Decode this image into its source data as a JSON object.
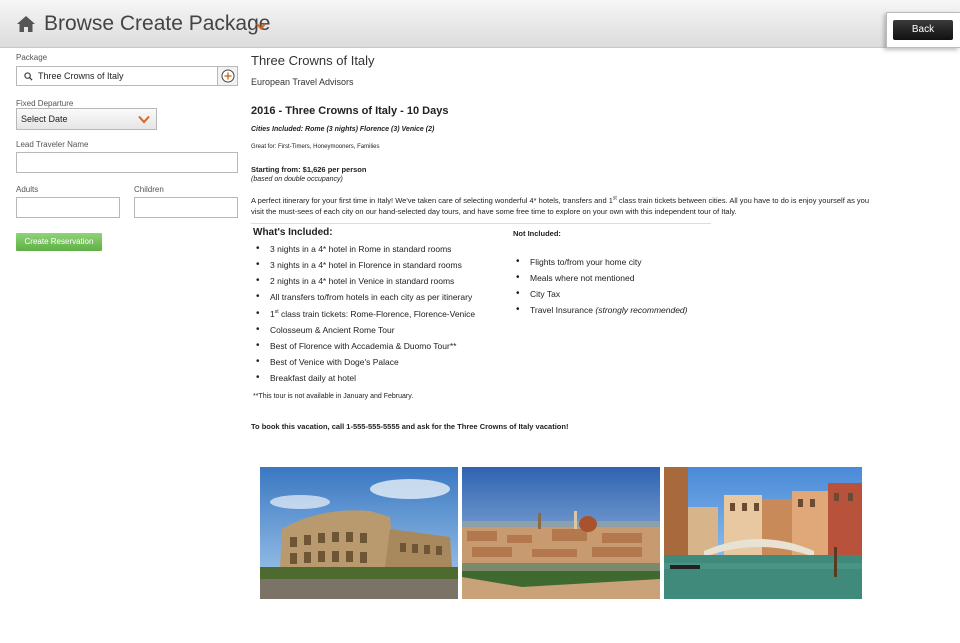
{
  "header": {
    "title": "Browse Create Package",
    "back_label": "Back"
  },
  "form": {
    "package_label": "Package",
    "package_value": "Three Crowns of Italy",
    "departure_label": "Fixed Departure",
    "departure_value": "Select Date",
    "lead_label": "Lead Traveler Name",
    "lead_value": "",
    "adults_label": "Adults",
    "adults_value": "",
    "children_label": "Children",
    "children_value": "",
    "create_label": "Create Reservation"
  },
  "details": {
    "package_title": "Three Crowns of Italy",
    "agency": "European Travel Advisors",
    "trip_title": "2016 - Three Crowns of Italy - 10 Days",
    "cities": "Cities Included: Rome (3 nights) Florence (3) Venice (2)",
    "great_for": "Great for: First-Timers, Honeymooners, Families",
    "starting": "Starting from: $1,626 per person",
    "occupancy": "(based on double occupancy)",
    "desc_part1": "A perfect itinerary for your first time in Italy!  We've taken care of selecting wonderful 4* hotels, transfers and 1",
    "desc_sup": "st",
    "desc_part2": " class train tickets between cities.  All you have to do is enjoy yourself as you visit the must-sees of each city on our hand-selected day tours, and have some free time to explore on your own with this independent tour of Italy.",
    "included_title": "What's Included:",
    "included": [
      "3 nights in a 4* hotel in Rome in standard rooms",
      "3 nights in a 4* hotel in Florence in standard rooms",
      "2 nights in a 4* hotel in Venice in standard rooms",
      "All transfers to/from hotels in each city as per itinerary",
      "class train tickets: Rome-Florence, Florence-Venice",
      "Colosseum & Ancient Rome Tour",
      "Best of Florence with Accademia & Duomo Tour**",
      "Best of Venice with Doge's Palace",
      "Breakfast daily at hotel"
    ],
    "included_5_prefix": "1",
    "included_5_sup": "st",
    "not_included_title": "Not Included:",
    "not_included": [
      "Flights to/from your home city",
      "Meals where not mentioned",
      "City Tax",
      "Travel Insurance"
    ],
    "not_included_4_note": "(strongly recommended)",
    "footnote": "**This tour is not available in January and February.",
    "booking": "To book this vacation, call 1-555-555-5555 and ask for the Three Crowns of Italy vacation!"
  },
  "colors": {
    "accent": "#d9661f",
    "green": "#6cbf52",
    "text": "#222222"
  }
}
